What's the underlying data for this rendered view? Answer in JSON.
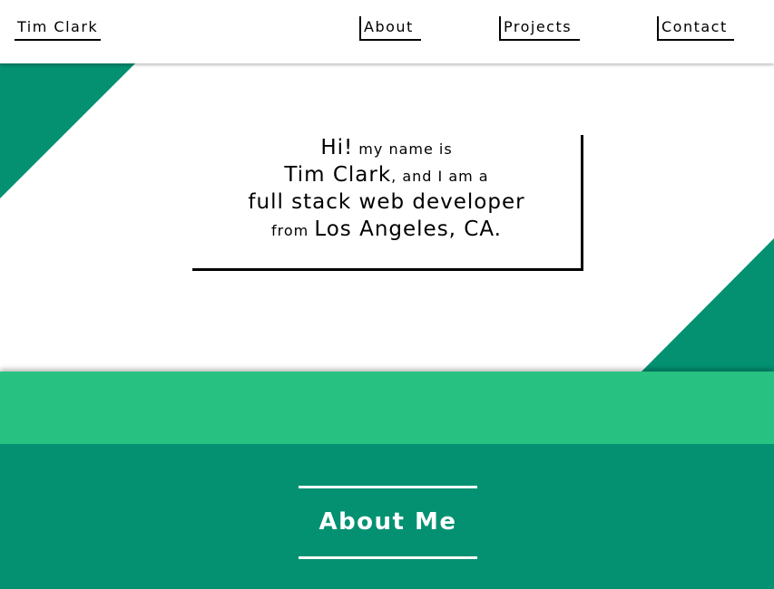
{
  "header": {
    "brand": "Tim Clark",
    "nav": {
      "about": "About",
      "projects": "Projects",
      "contact": "Contact"
    }
  },
  "hero": {
    "line1": {
      "emphasis": "Hi!",
      "rest": " my name is"
    },
    "line2": {
      "emphasis": "Tim Clark",
      "rest": ", and I am a"
    },
    "line3": {
      "emphasis": "full stack web developer"
    },
    "line4": {
      "lead": "from ",
      "emphasis": "Los Angeles, CA."
    }
  },
  "about": {
    "heading": "About Me"
  },
  "colors": {
    "dark_green": "#039172",
    "light_green": "#27c281",
    "text": "#000000",
    "background": "#ffffff"
  }
}
